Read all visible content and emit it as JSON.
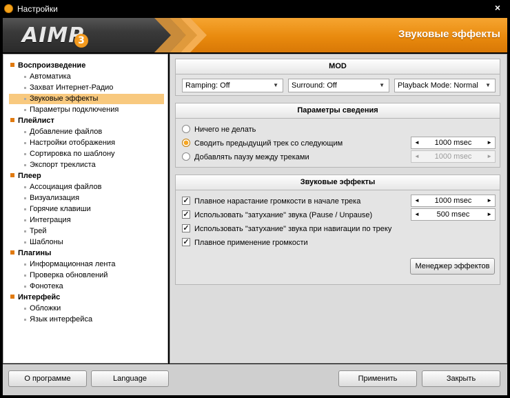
{
  "window": {
    "title": "Настройки",
    "close_glyph": "×"
  },
  "banner": {
    "logo_text": "AIMP",
    "logo_version": "3",
    "section_title": "Звуковые эффекты"
  },
  "sidebar": {
    "categories": [
      {
        "label": "Воспроизведение",
        "items": [
          "Автоматика",
          "Захват Интернет-Радио",
          "Звуковые эффекты",
          "Параметры подключения"
        ]
      },
      {
        "label": "Плейлист",
        "items": [
          "Добавление файлов",
          "Настройки отображения",
          "Сортировка по шаблону",
          "Экспорт треклиста"
        ]
      },
      {
        "label": "Плеер",
        "items": [
          "Ассоциация файлов",
          "Визуализация",
          "Горячие клавиши",
          "Интеграция",
          "Трей",
          "Шаблоны"
        ]
      },
      {
        "label": "Плагины",
        "items": [
          "Информационная лента",
          "Проверка обновлений",
          "Фонотека"
        ]
      },
      {
        "label": "Интерфейс",
        "items": [
          "Обложки",
          "Язык интерфейса"
        ]
      }
    ],
    "selected": "Звуковые эффекты"
  },
  "mod": {
    "header": "MOD",
    "ramping": "Ramping: Off",
    "surround": "Surround: Off",
    "playback_mode": "Playback Mode: Normal"
  },
  "mixing": {
    "header": "Параметры сведения",
    "options": [
      "Ничего не делать",
      "Сводить предыдущий трек со следующим",
      "Добавлять паузу между треками"
    ],
    "selected_index": 1,
    "crossfade_value": "1000 msec",
    "pause_value": "1000 msec"
  },
  "effects": {
    "header": "Звуковые эффекты",
    "options": [
      "Плавное нарастание громкости в начале трека",
      "Использовать \"затухание\" звука (Pause / Unpause)",
      "Использовать \"затухание\" звука при навигации по треку",
      "Плавное применение громкости"
    ],
    "checked": [
      true,
      true,
      true,
      true
    ],
    "fade_in_value": "1000 msec",
    "pause_fade_value": "500 msec",
    "manager_button": "Менеджер эффектов"
  },
  "buttons": {
    "about": "О программе",
    "language": "Language",
    "apply": "Применить",
    "close": "Закрыть"
  },
  "colors": {
    "accent": "#f39a1f",
    "selection": "#f8c97f",
    "bullet": "#e07a10"
  },
  "icons": {
    "check": "✓",
    "spin_left": "◄",
    "spin_right": "►",
    "dropdown": "▼"
  }
}
